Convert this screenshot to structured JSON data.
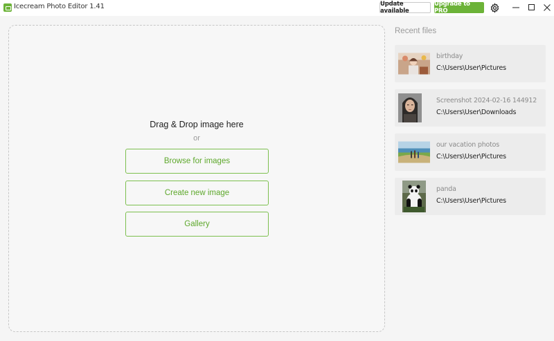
{
  "window": {
    "title": "Icecream Photo Editor 1.41",
    "update_label": "Update available",
    "upgrade_label": "Upgrade to PRO",
    "settings_icon": "gear-icon",
    "minimize_icon": "minimize-icon",
    "maximize_icon": "maximize-icon",
    "close_icon": "close-icon"
  },
  "colors": {
    "accent": "#6cb338",
    "accent_text": "#5ea82c"
  },
  "dropzone": {
    "title": "Drag & Drop image here",
    "or": "or",
    "buttons": [
      {
        "label": "Browse for images"
      },
      {
        "label": "Create new image"
      },
      {
        "label": "Gallery"
      }
    ]
  },
  "recent": {
    "title": "Recent files",
    "items": [
      {
        "name": "birthday",
        "path": "C:\\Users\\User\\Pictures"
      },
      {
        "name": "Screenshot 2024-02-16 144912",
        "path": "C:\\Users\\User\\Downloads"
      },
      {
        "name": "our vacation photos",
        "path": "C:\\Users\\User\\Pictures"
      },
      {
        "name": "panda",
        "path": "C:\\Users\\User\\Pictures"
      }
    ]
  }
}
